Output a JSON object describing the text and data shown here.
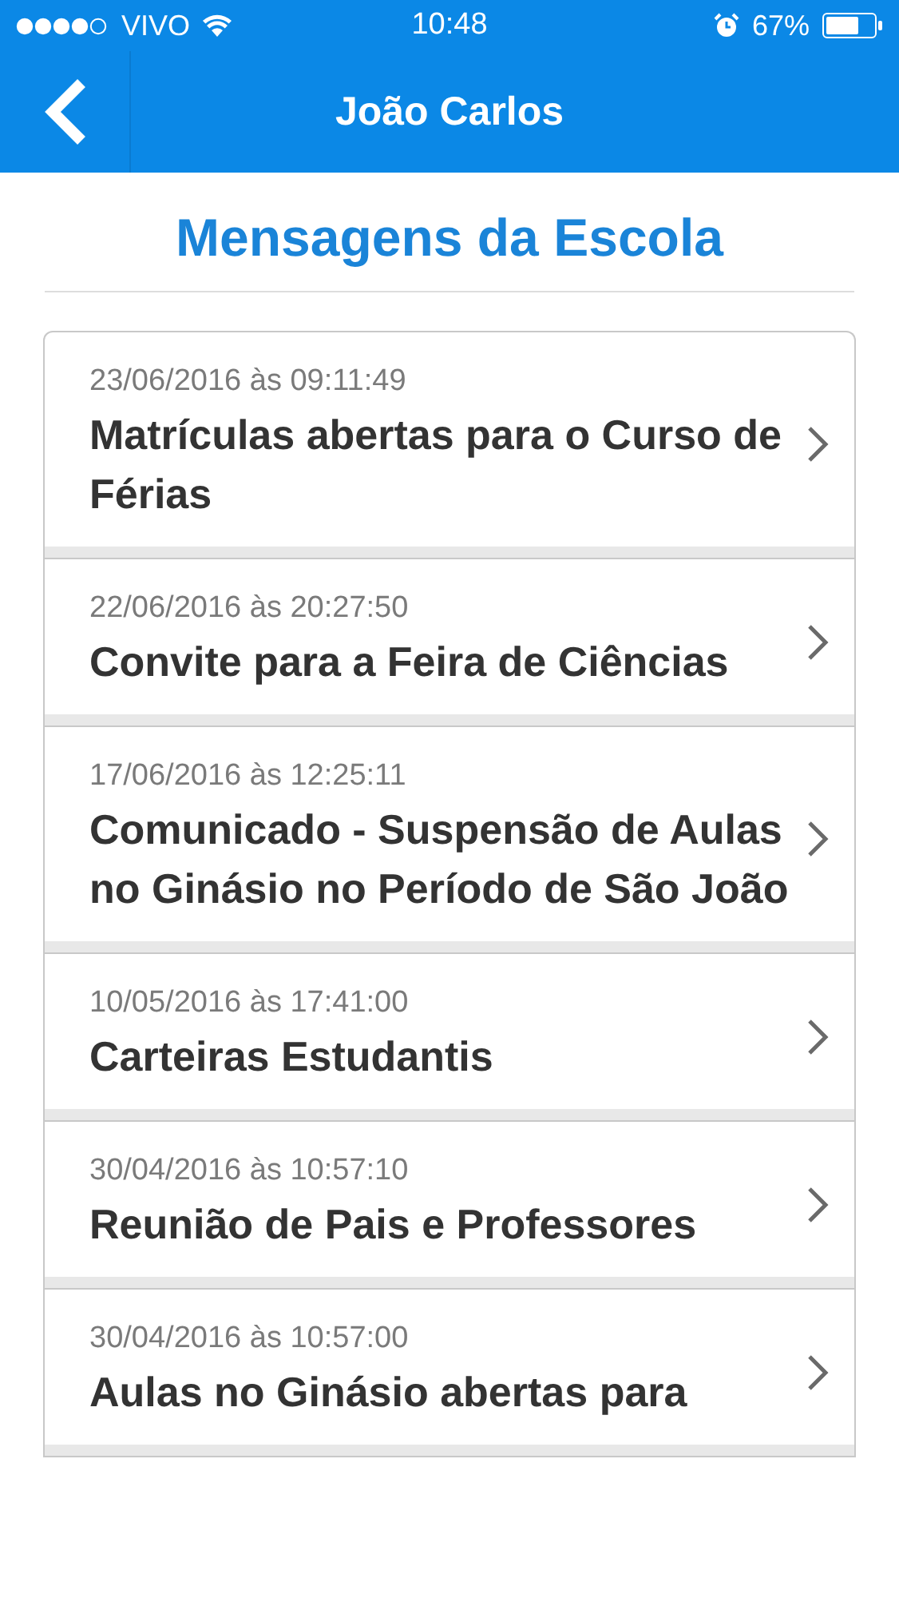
{
  "status_bar": {
    "carrier": "VIVO",
    "time": "10:48",
    "battery": "67%"
  },
  "nav_bar": {
    "title": "João Carlos"
  },
  "heading": "Mensagens da Escola",
  "messages": [
    {
      "date": "23/06/2016 às 09:11:49",
      "title": "Matrículas abertas para o Curso de Férias"
    },
    {
      "date": "22/06/2016 às 20:27:50",
      "title": "Convite para a Feira de Ciências"
    },
    {
      "date": "17/06/2016 às 12:25:11",
      "title": "Comunicado - Suspensão de Aulas no Ginásio no Período de São João"
    },
    {
      "date": "10/05/2016 às 17:41:00",
      "title": "Carteiras Estudantis"
    },
    {
      "date": "30/04/2016 às 10:57:10",
      "title": "Reunião de Pais e Professores"
    },
    {
      "date": "30/04/2016 às 10:57:00",
      "title": "Aulas no Ginásio abertas para"
    }
  ]
}
